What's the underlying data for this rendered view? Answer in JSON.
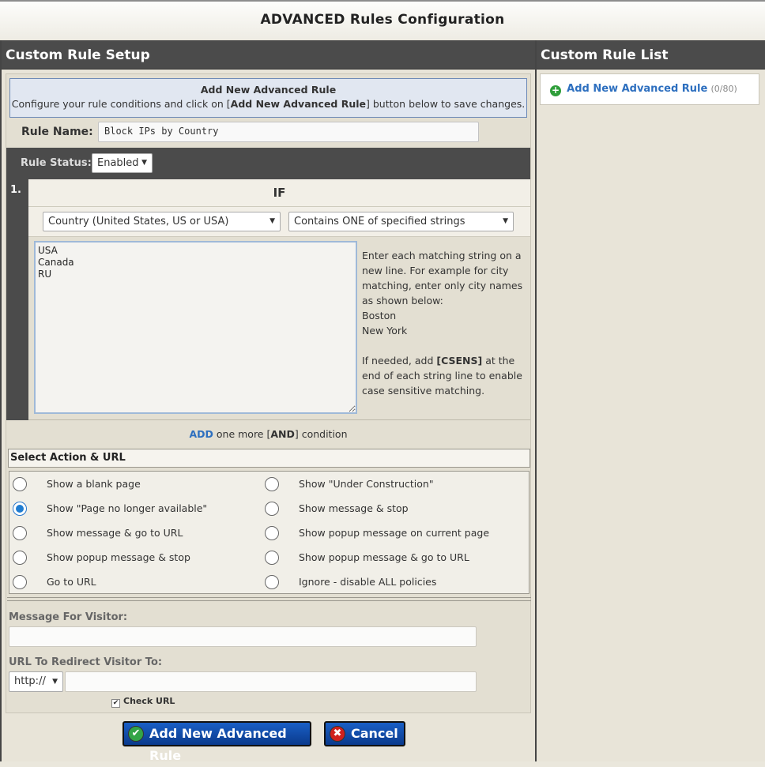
{
  "title": "ADVANCED Rules Configuration",
  "left_panel": {
    "heading": "Custom Rule Setup",
    "notice": {
      "title": "Add New Advanced Rule",
      "text_before": "Configure your rule conditions and click on [",
      "text_bold": "Add New Advanced Rule",
      "text_after": "] button below to save changes."
    },
    "rule_name_label": "Rule Name:",
    "rule_name_value": "Block IPs by Country",
    "rule_status_label": "Rule Status:",
    "rule_status_value": "Enabled",
    "condition": {
      "number": "1.",
      "heading": "IF",
      "field_select": "Country (United States, US or USA)",
      "operator_select": "Contains ONE of specified strings",
      "values_text": "USA\nCanada\nRU",
      "help_lines": [
        "Enter each matching string on a new line. For example for city matching, enter only city names as shown below:",
        "Boston",
        "New York"
      ],
      "help2_before": "If needed, add ",
      "help2_bold": "[CSENS]",
      "help2_after": " at the end of each string line to enable case sensitive matching."
    },
    "add_condition": {
      "link": "ADD",
      "middle": " one more [",
      "bold": "AND",
      "end": "] condition"
    },
    "action_heading": "Select Action & URL",
    "actions": [
      {
        "label": "Show a blank page",
        "selected": false
      },
      {
        "label": "Show \"Under Construction\"",
        "selected": false
      },
      {
        "label": "Show \"Page no longer available\"",
        "selected": true
      },
      {
        "label": "Show message & stop",
        "selected": false
      },
      {
        "label": "Show message & go to URL",
        "selected": false
      },
      {
        "label": "Show popup message on current page",
        "selected": false
      },
      {
        "label": "Show popup message & stop",
        "selected": false
      },
      {
        "label": "Show popup message & go to URL",
        "selected": false
      },
      {
        "label": "Go to URL",
        "selected": false
      },
      {
        "label": "Ignore - disable ALL policies",
        "selected": false
      }
    ],
    "message_label": "Message For Visitor:",
    "message_value": "",
    "url_label": "URL To Redirect Visitor To:",
    "url_protocol": "http://",
    "url_value": "",
    "check_url_label": "Check URL",
    "check_url_checked": true,
    "add_button": "Add New Advanced Rule",
    "cancel_button": "Cancel"
  },
  "right_panel": {
    "heading": "Custom Rule List",
    "add_link": "Add New Advanced Rule",
    "count": "(0/80)"
  },
  "colors": {
    "accent_blue": "#2d6fbf",
    "header_dark": "#4b4b4b",
    "check_green": "#2f9e3a",
    "cancel_red": "#d0201c"
  }
}
